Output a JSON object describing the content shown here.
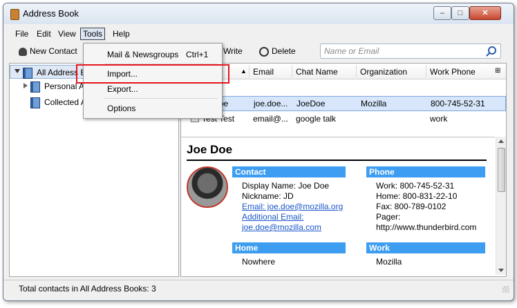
{
  "window": {
    "title": "Address Book"
  },
  "menubar": [
    "File",
    "Edit",
    "View",
    "Tools",
    "Help"
  ],
  "toolbar": {
    "new_contact": "New Contact",
    "write": "Write",
    "delete": "Delete"
  },
  "search": {
    "placeholder": "Name or Email"
  },
  "tree": {
    "items": [
      {
        "label": "All Address B"
      },
      {
        "label": "Personal A"
      },
      {
        "label": "Collected A"
      }
    ]
  },
  "columns": {
    "name_tail": "e",
    "email": "Email",
    "chat": "Chat Name",
    "org": "Organization",
    "phone": "Work Phone"
  },
  "rows": {
    "row0": {
      "frag": "t"
    },
    "row1": {
      "name": "oe",
      "email": "joe.doe...",
      "chat": "JoeDoe",
      "org": "Mozilla",
      "phone": "800-745-52-31"
    },
    "row2": {
      "name": "Test Test",
      "email": "email@...",
      "chat": "google talk",
      "phone": "work"
    }
  },
  "detail": {
    "name": "Joe Doe",
    "contact_head": "Contact",
    "display_name": "Display Name: Joe Doe",
    "nickname": "Nickname: JD",
    "email": "Email: joe.doe@mozilla.org",
    "additional_email_label": "Additional Email:",
    "additional_email": "joe.doe@mozilla.com",
    "phone_head": "Phone",
    "work": "Work: 800-745-52-31",
    "home": "Home: 800-831-22-10",
    "fax": "Fax: 800-789-0102",
    "pager": "Pager:",
    "website": "http://www.thunderbird.com",
    "home_head": "Home",
    "home_line": "Nowhere",
    "work_head": "Work",
    "work_line": "Mozilla"
  },
  "tools_menu": {
    "mail_newsgroups": "Mail & Newsgroups",
    "mail_shortcut": "Ctrl+1",
    "import": "Import...",
    "export": "Export...",
    "options": "Options"
  },
  "status": {
    "text": "Total contacts in All Address Books: 3"
  },
  "colors": {
    "accent": "#3d9df0",
    "highlight": "#e3141b",
    "selection": "#d7e6fb"
  }
}
